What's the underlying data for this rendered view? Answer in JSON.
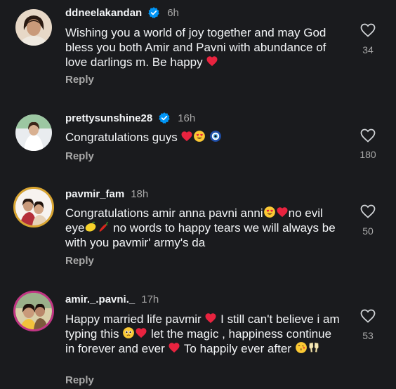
{
  "comments": [
    {
      "username": "ddneelakandan",
      "time": "6h",
      "verified": true,
      "text": "Wishing you a world of joy together and may God bless you both Amir and Pavni with abundance of love darlings m. Be happy",
      "likes": "34",
      "reply": "Reply"
    },
    {
      "username": "prettysunshine28",
      "time": "16h",
      "verified": true,
      "text": "Congratulations guys",
      "likes": "180",
      "reply": "Reply"
    },
    {
      "username": "pavmir_fam",
      "time": "18h",
      "verified": false,
      "text_parts": [
        "Congratulations amir anna pavni anni",
        "no evil eye",
        " no words to happy tears we will always be with you pavmir' army's da"
      ],
      "likes": "50",
      "reply": "Reply"
    },
    {
      "username": "amir._.pavni._",
      "time": "17h",
      "verified": false,
      "text_parts": [
        "Happy married life pavmir ",
        " I still can't believe i am typing this ",
        " let the magic , happiness continue in forever and ever ",
        " To happily ever after "
      ],
      "likes": "53",
      "reply": "Reply"
    }
  ],
  "icons": {
    "verified": "verified-badge-icon",
    "like": "heart-outline-icon",
    "heart_emoji": "red-heart-emoji",
    "heart_eyes": "heart-eyes-emoji",
    "evil_eye": "nazar-amulet-emoji",
    "lemon": "lemon-emoji",
    "chili": "hot-pepper-emoji",
    "teary": "pleading-face-emoji",
    "kiss": "face-blowing-kiss-emoji",
    "cheers": "clinking-glasses-emoji"
  },
  "colors": {
    "background": "#1a1b1e",
    "verified": "#0095f6",
    "heart": "#e8233f",
    "secondary_text": "#a8a8a8"
  }
}
